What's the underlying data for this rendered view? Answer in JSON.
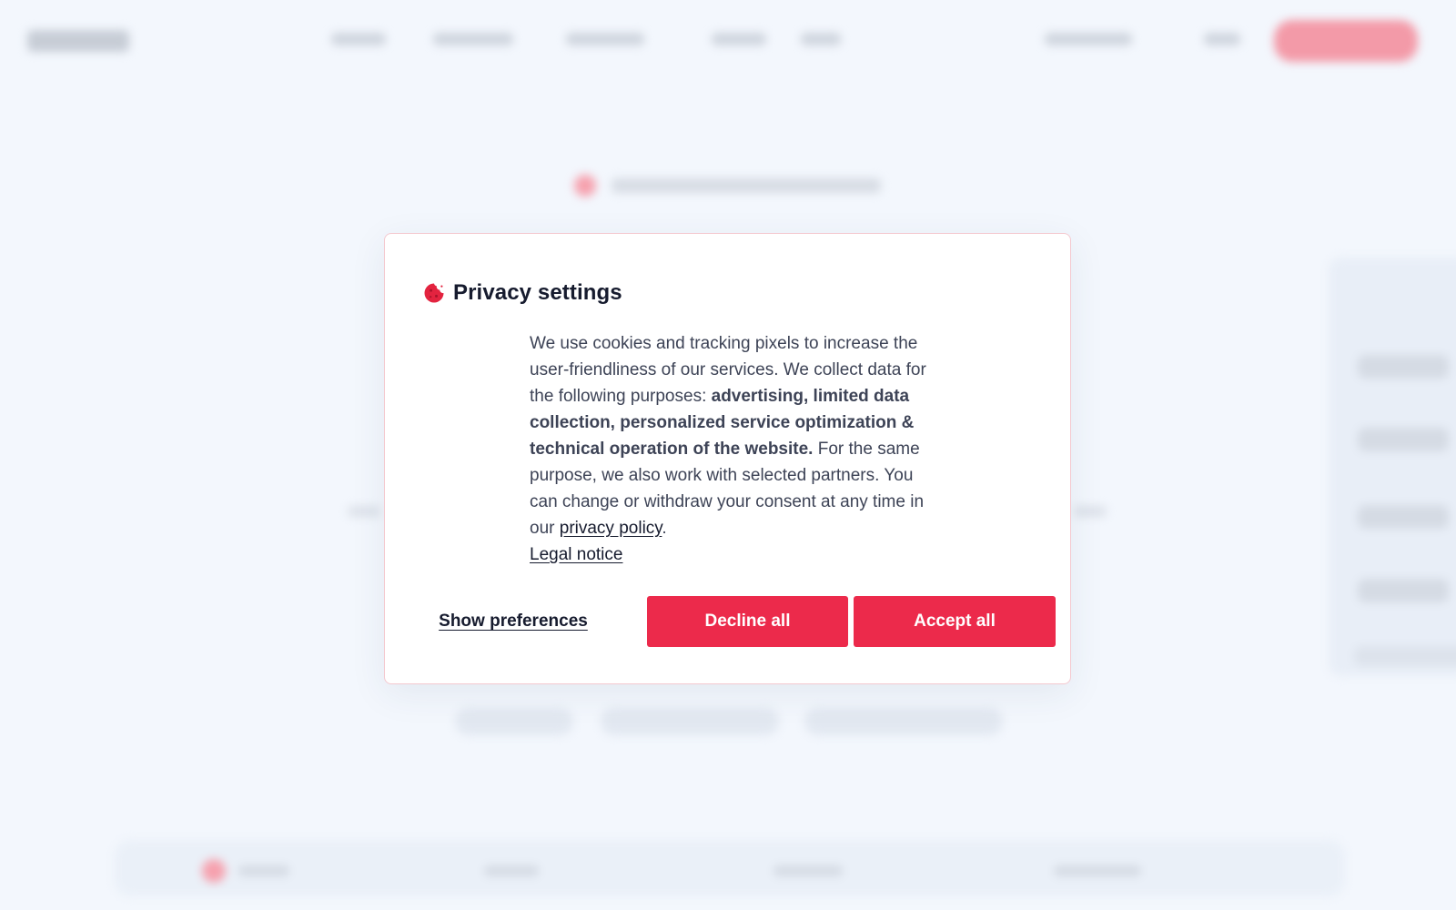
{
  "colors": {
    "accent": "#ec2a4b",
    "title": "#161b2e",
    "body_text": "#3d4356",
    "background": "#f3f7fd",
    "modal_border": "#f4c8cf"
  },
  "modal": {
    "icon": "cookie-icon",
    "title": "Privacy settings",
    "body_intro": "We use cookies and tracking pixels to increase the user-friendliness of our services. We collect data for the following purposes: ",
    "body_purposes": "advertising, limited data collection, personalized service optimization & technical operation of the website.",
    "body_partners": " For the same purpose, we also work with selected partners. You can change or withdraw your consent at any time in our ",
    "privacy_policy_label": "privacy policy",
    "period": ".",
    "legal_notice_label": "Legal notice",
    "buttons": {
      "show_preferences": "Show preferences",
      "decline_all": "Decline all",
      "accept_all": "Accept all"
    }
  }
}
